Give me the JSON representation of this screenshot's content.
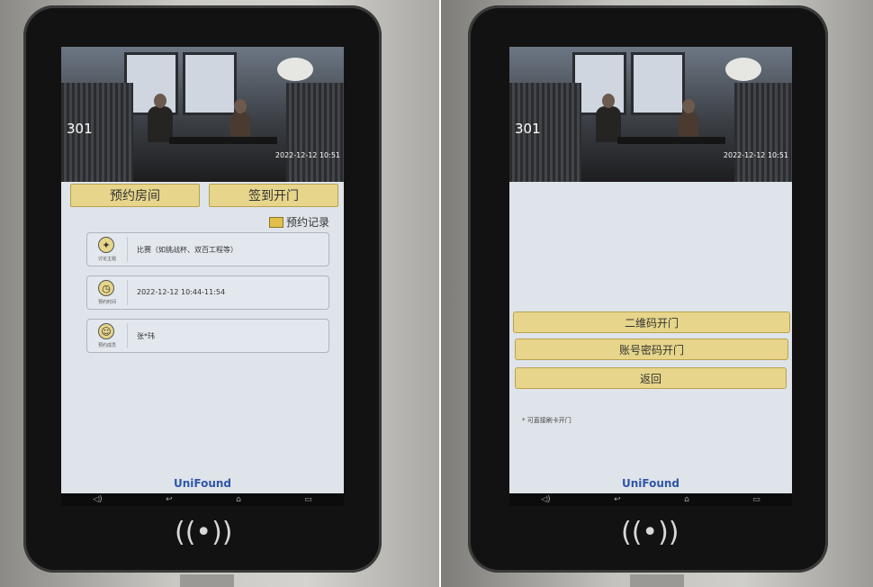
{
  "left_screen": {
    "room_number": "301",
    "datetime": "2022-12-12 10:51",
    "buttons": {
      "reserve_room": "预约房间",
      "checkin_open": "签到开门"
    },
    "records_label": "预约记录",
    "fields": [
      {
        "icon": "lightbulb-icon",
        "caption": "讨论主题",
        "value": "比赛（如挑战杯、双百工程等）"
      },
      {
        "icon": "clock-icon",
        "caption": "预约时间",
        "value": "2022-12-12 10:44-11:54"
      },
      {
        "icon": "person-icon",
        "caption": "预约成员",
        "value": "张*玮"
      }
    ],
    "brand": "UniFound"
  },
  "right_screen": {
    "room_number": "301",
    "datetime": "2022-12-12 10:51",
    "actions": {
      "qr_open": "二维码开门",
      "account_open": "账号密码开门",
      "back": "返回"
    },
    "hint": "* 可直接刷卡开门",
    "brand": "UniFound"
  },
  "colors": {
    "button_gold": "#e6d58a",
    "brand_blue": "#2f56a8"
  }
}
